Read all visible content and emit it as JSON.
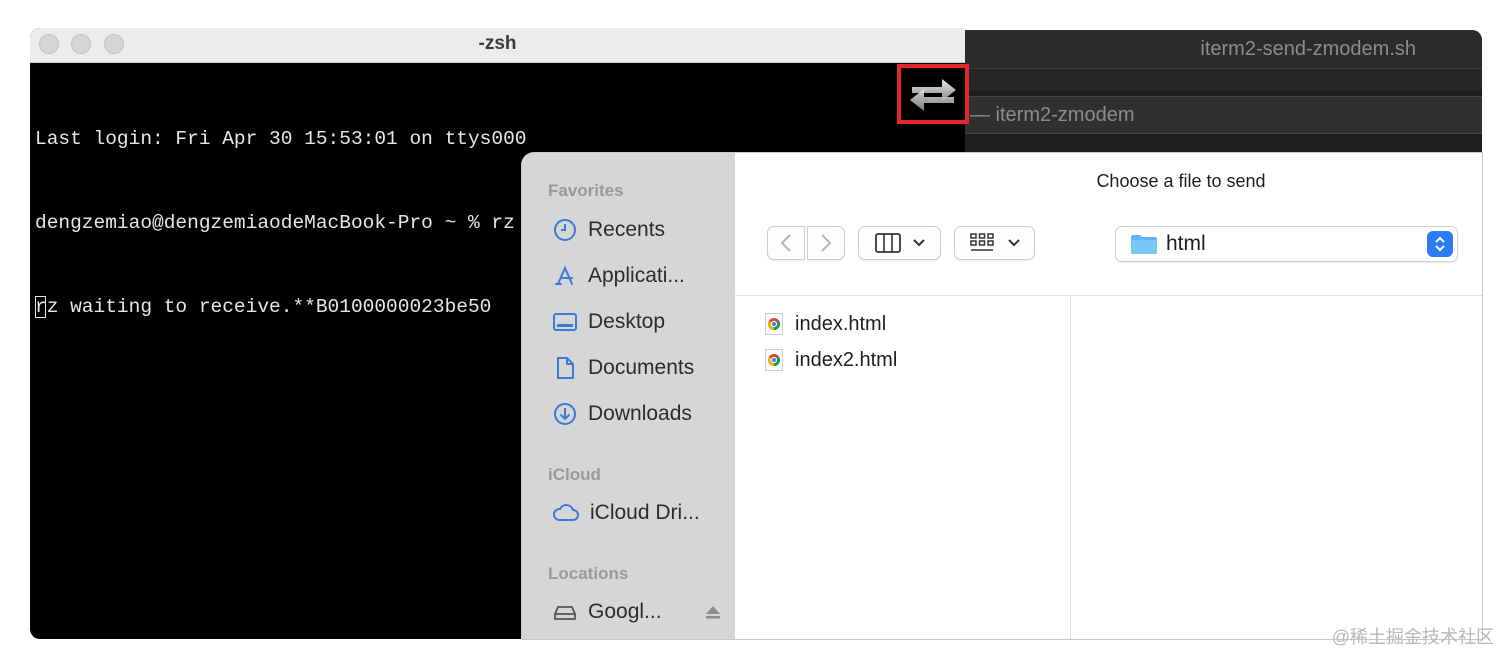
{
  "background_window": {
    "title": "iterm2-send-zmodem.sh",
    "subtitle": "— iterm2-zmodem"
  },
  "terminal": {
    "title": "-zsh",
    "lines": [
      "Last login: Fri Apr 30 15:53:01 on ttys000",
      "dengzemiao@dengzemiaodeMacBook-Pro ~ % rz",
      "rz waiting to receive.**B0100000023be50"
    ]
  },
  "highlight": {
    "icon": "transfer-arrows-icon",
    "color": "#e0282a"
  },
  "dialog": {
    "title": "Choose a file to send",
    "sidebar": {
      "favorites_label": "Favorites",
      "favorites": [
        {
          "label": "Recents",
          "icon": "clock-icon"
        },
        {
          "label": "Applicati...",
          "icon": "applications-icon"
        },
        {
          "label": "Desktop",
          "icon": "desktop-icon"
        },
        {
          "label": "Documents",
          "icon": "document-icon"
        },
        {
          "label": "Downloads",
          "icon": "download-icon"
        }
      ],
      "icloud_label": "iCloud",
      "icloud": [
        {
          "label": "iCloud Dri...",
          "icon": "cloud-icon"
        }
      ],
      "locations_label": "Locations",
      "locations": [
        {
          "label": "Googl...",
          "icon": "drive-icon"
        }
      ]
    },
    "location": "html",
    "files": [
      {
        "name": "index.html",
        "icon": "chrome-icon"
      },
      {
        "name": "index2.html",
        "icon": "chrome-icon"
      }
    ]
  },
  "watermark": "@稀土掘金技术社区",
  "colors": {
    "accent": "#2c7cf6",
    "sidebar_bg": "#d6d6d6",
    "terminal_bg": "#000000"
  }
}
